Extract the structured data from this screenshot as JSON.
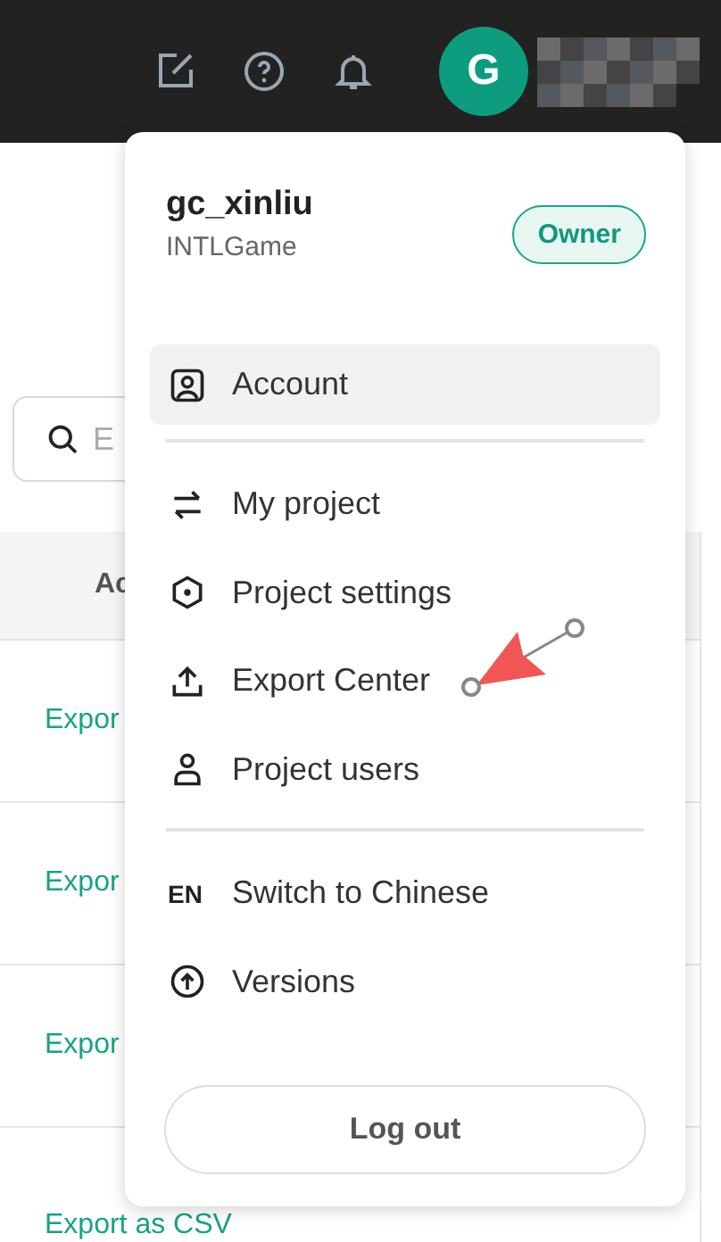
{
  "top_bar": {
    "avatar_letter": "G"
  },
  "background": {
    "search": {
      "placeholder": "E"
    },
    "table": {
      "column_header": "Ac",
      "rows": [
        "Expor",
        "Expor",
        "Expor",
        "Export as CSV"
      ]
    }
  },
  "user_menu": {
    "username": "gc_xinliu",
    "organization": "INTLGame",
    "role_badge": "Owner",
    "groups": [
      [
        {
          "label": "Account",
          "kind": "icon",
          "selected": true
        }
      ],
      [
        {
          "label": "My project",
          "kind": "icon",
          "selected": false
        },
        {
          "label": "Project settings",
          "kind": "icon",
          "selected": false
        },
        {
          "label": "Export Center",
          "kind": "icon",
          "selected": false
        },
        {
          "label": "Project users",
          "kind": "icon",
          "selected": false
        }
      ],
      [
        {
          "label": "Switch to Chinese",
          "kind": "text",
          "icon_text": "EN",
          "selected": false
        },
        {
          "label": "Versions",
          "kind": "icon",
          "selected": false
        }
      ]
    ],
    "logout_button": "Log out"
  }
}
